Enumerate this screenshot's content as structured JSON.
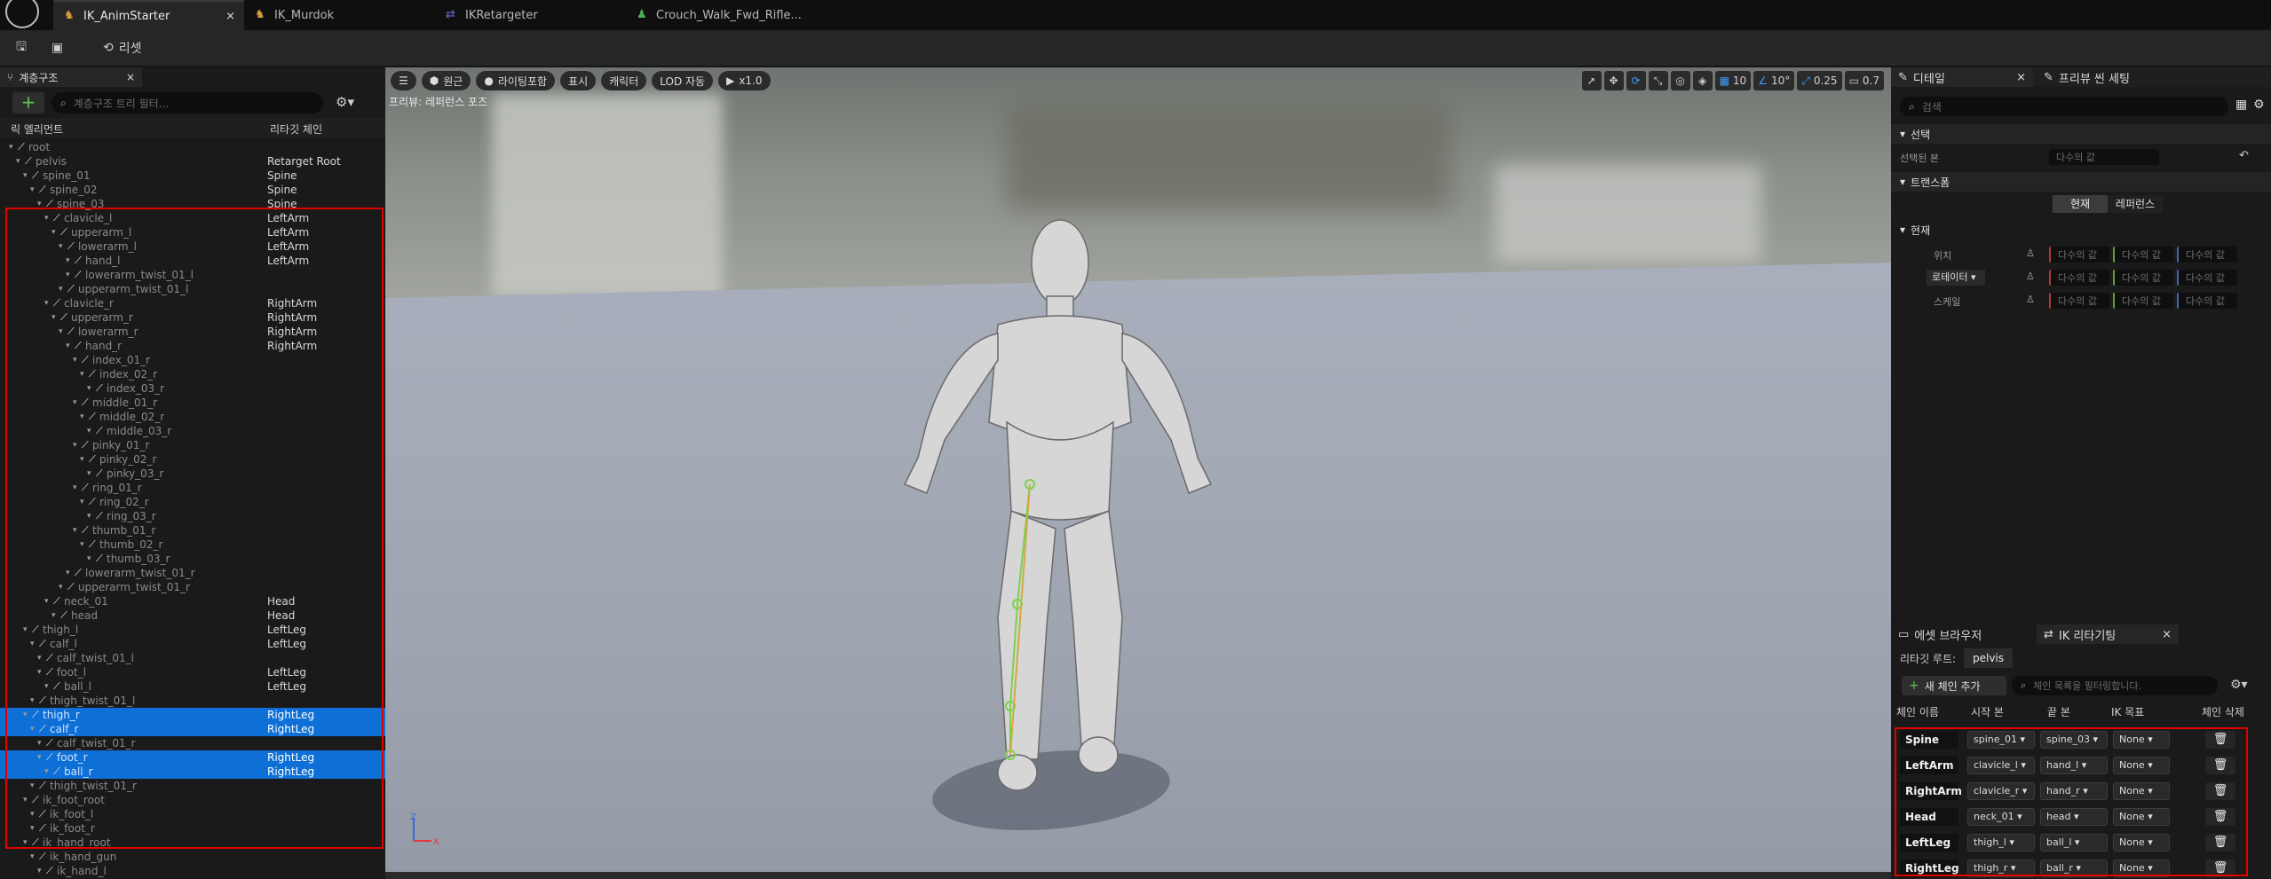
{
  "tabs": [
    {
      "label": "IK_AnimStarter",
      "close": "×"
    },
    {
      "label": "IK_Murdok"
    },
    {
      "label": "IKRetargeter"
    },
    {
      "label": "Crouch_Walk_Fwd_Rifle..."
    }
  ],
  "toolbar": {
    "reset_label": "리셋"
  },
  "hierarchy": {
    "tab_label": "계층구조",
    "close": "×",
    "add_icon": "+",
    "search_placeholder": "계층구조 트리 필터...",
    "col_element": "릭 엘리먼트",
    "col_chain": "리타깃 체인",
    "rows": [
      {
        "name": "root",
        "chain": "",
        "indent": 0,
        "sel": false
      },
      {
        "name": "pelvis",
        "chain": "Retarget Root",
        "indent": 1,
        "sel": false
      },
      {
        "name": "spine_01",
        "chain": "Spine",
        "indent": 2,
        "sel": false
      },
      {
        "name": "spine_02",
        "chain": "Spine",
        "indent": 3,
        "sel": false
      },
      {
        "name": "spine_03",
        "chain": "Spine",
        "indent": 4,
        "sel": false
      },
      {
        "name": "clavicle_l",
        "chain": "LeftArm",
        "indent": 5,
        "sel": false
      },
      {
        "name": "upperarm_l",
        "chain": "LeftArm",
        "indent": 6,
        "sel": false
      },
      {
        "name": "lowerarm_l",
        "chain": "LeftArm",
        "indent": 7,
        "sel": false
      },
      {
        "name": "hand_l",
        "chain": "LeftArm",
        "indent": 8,
        "sel": false
      },
      {
        "name": "lowerarm_twist_01_l",
        "chain": "",
        "indent": 8,
        "sel": false
      },
      {
        "name": "upperarm_twist_01_l",
        "chain": "",
        "indent": 7,
        "sel": false
      },
      {
        "name": "clavicle_r",
        "chain": "RightArm",
        "indent": 5,
        "sel": false
      },
      {
        "name": "upperarm_r",
        "chain": "RightArm",
        "indent": 6,
        "sel": false
      },
      {
        "name": "lowerarm_r",
        "chain": "RightArm",
        "indent": 7,
        "sel": false
      },
      {
        "name": "hand_r",
        "chain": "RightArm",
        "indent": 8,
        "sel": false
      },
      {
        "name": "index_01_r",
        "chain": "",
        "indent": 9,
        "sel": false
      },
      {
        "name": "index_02_r",
        "chain": "",
        "indent": 10,
        "sel": false
      },
      {
        "name": "index_03_r",
        "chain": "",
        "indent": 11,
        "sel": false
      },
      {
        "name": "middle_01_r",
        "chain": "",
        "indent": 9,
        "sel": false
      },
      {
        "name": "middle_02_r",
        "chain": "",
        "indent": 10,
        "sel": false
      },
      {
        "name": "middle_03_r",
        "chain": "",
        "indent": 11,
        "sel": false
      },
      {
        "name": "pinky_01_r",
        "chain": "",
        "indent": 9,
        "sel": false
      },
      {
        "name": "pinky_02_r",
        "chain": "",
        "indent": 10,
        "sel": false
      },
      {
        "name": "pinky_03_r",
        "chain": "",
        "indent": 11,
        "sel": false
      },
      {
        "name": "ring_01_r",
        "chain": "",
        "indent": 9,
        "sel": false
      },
      {
        "name": "ring_02_r",
        "chain": "",
        "indent": 10,
        "sel": false
      },
      {
        "name": "ring_03_r",
        "chain": "",
        "indent": 11,
        "sel": false
      },
      {
        "name": "thumb_01_r",
        "chain": "",
        "indent": 9,
        "sel": false
      },
      {
        "name": "thumb_02_r",
        "chain": "",
        "indent": 10,
        "sel": false
      },
      {
        "name": "thumb_03_r",
        "chain": "",
        "indent": 11,
        "sel": false
      },
      {
        "name": "lowerarm_twist_01_r",
        "chain": "",
        "indent": 8,
        "sel": false
      },
      {
        "name": "upperarm_twist_01_r",
        "chain": "",
        "indent": 7,
        "sel": false
      },
      {
        "name": "neck_01",
        "chain": "Head",
        "indent": 5,
        "sel": false
      },
      {
        "name": "head",
        "chain": "Head",
        "indent": 6,
        "sel": false
      },
      {
        "name": "thigh_l",
        "chain": "LeftLeg",
        "indent": 2,
        "sel": false
      },
      {
        "name": "calf_l",
        "chain": "LeftLeg",
        "indent": 3,
        "sel": false
      },
      {
        "name": "calf_twist_01_l",
        "chain": "",
        "indent": 4,
        "sel": false
      },
      {
        "name": "foot_l",
        "chain": "LeftLeg",
        "indent": 4,
        "sel": false
      },
      {
        "name": "ball_l",
        "chain": "LeftLeg",
        "indent": 5,
        "sel": false
      },
      {
        "name": "thigh_twist_01_l",
        "chain": "",
        "indent": 3,
        "sel": false
      },
      {
        "name": "thigh_r",
        "chain": "RightLeg",
        "indent": 2,
        "sel": true
      },
      {
        "name": "calf_r",
        "chain": "RightLeg",
        "indent": 3,
        "sel": true
      },
      {
        "name": "calf_twist_01_r",
        "chain": "",
        "indent": 4,
        "sel": false
      },
      {
        "name": "foot_r",
        "chain": "RightLeg",
        "indent": 4,
        "sel": true
      },
      {
        "name": "ball_r",
        "chain": "RightLeg",
        "indent": 5,
        "sel": true
      },
      {
        "name": "thigh_twist_01_r",
        "chain": "",
        "indent": 3,
        "sel": false
      },
      {
        "name": "ik_foot_root",
        "chain": "",
        "indent": 2,
        "sel": false
      },
      {
        "name": "ik_foot_l",
        "chain": "",
        "indent": 3,
        "sel": false
      },
      {
        "name": "ik_foot_r",
        "chain": "",
        "indent": 3,
        "sel": false
      },
      {
        "name": "ik_hand_root",
        "chain": "",
        "indent": 2,
        "sel": false
      },
      {
        "name": "ik_hand_gun",
        "chain": "",
        "indent": 3,
        "sel": false
      },
      {
        "name": "ik_hand_l",
        "chain": "",
        "indent": 4,
        "sel": false
      }
    ]
  },
  "viewport": {
    "buttons": [
      "원근",
      "라이팅포함",
      "표시",
      "캐릭터",
      "LOD 자동",
      "x1.0"
    ],
    "label": "프리뷰: 레퍼런스 포즈",
    "grid_value": "10",
    "angle_value": "10°",
    "scale_value": "0.25",
    "camera_value": "0.7",
    "axis_z": "Z",
    "axis_x": "X"
  },
  "details": {
    "tab_label": "디테일",
    "close": "×",
    "tab2_label": "프리뷰 씬 세팅",
    "search_placeholder": "검색",
    "section_select": "선택",
    "selected_bone_label": "선택된 본",
    "selected_bone_value": "다수의 값",
    "section_transform": "트랜스폼",
    "mode_current": "현재",
    "mode_reference": "레퍼런스",
    "section_current": "현재",
    "location_label": "위치",
    "rotation_label": "로테이터",
    "scale_label": "스케일",
    "multi": "다수의 값"
  },
  "retarget": {
    "tab1": "에셋 브라우저",
    "tab2": "IK 리타기팅",
    "close": "×",
    "root_label": "리타깃 루트:",
    "root_value": "pelvis",
    "add_chain": "새 체인 추가",
    "filter_placeholder": "체인 목록을 필터링합니다.",
    "col_name": "체인 이름",
    "col_start": "시작 본",
    "col_end": "끝 본",
    "col_goal": "IK 목표",
    "col_delete": "체인 삭제",
    "chains": [
      {
        "name": "Spine",
        "start": "spine_01",
        "end": "spine_03",
        "goal": "None"
      },
      {
        "name": "LeftArm",
        "start": "clavicle_l",
        "end": "hand_l",
        "goal": "None"
      },
      {
        "name": "RightArm",
        "start": "clavicle_r",
        "end": "hand_r",
        "goal": "None"
      },
      {
        "name": "Head",
        "start": "neck_01",
        "end": "head",
        "goal": "None"
      },
      {
        "name": "LeftLeg",
        "start": "thigh_l",
        "end": "ball_l",
        "goal": "None"
      },
      {
        "name": "RightLeg",
        "start": "thigh_r",
        "end": "ball_r",
        "goal": "None"
      }
    ]
  }
}
